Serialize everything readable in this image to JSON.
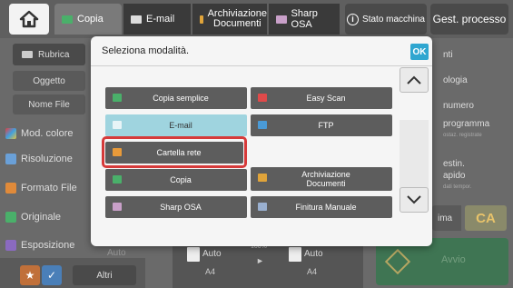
{
  "topbar": {
    "tabs": [
      {
        "label": "Copia"
      },
      {
        "label": "E-mail"
      },
      {
        "label_line1": "Archiviazione",
        "label_line2": "Documenti"
      },
      {
        "label": "Sharp OSA"
      }
    ],
    "stato": "Stato macchina",
    "gestione": "Gest. processo"
  },
  "left": {
    "rubrica": "Rubrica",
    "oggetto": "Oggetto",
    "nome_file": "Nome File",
    "mod_colore": "Mod. colore",
    "risoluzione": "Risoluzione",
    "formato_file": "Formato File",
    "originale": "Originale",
    "esposizione": "Esposizione",
    "esposizione_val": "Auto",
    "altri": "Altri"
  },
  "right": {
    "invii": "nti",
    "tipologia": "ologia",
    "numero": "numero",
    "programma": "programma",
    "programma_sub": "ostaz. registrate",
    "destin": "estin.",
    "rapido": "apido",
    "rapido_sub": "dati tempor.",
    "ima": "ima",
    "ca": "CA"
  },
  "bottom": {
    "auto1": "Auto",
    "a4_1": "A4",
    "pct": "100%",
    "auto2": "Auto",
    "a4_2": "A4",
    "avvio": "Avvio"
  },
  "dialog": {
    "title": "Seleziona modalità.",
    "ok": "OK",
    "modes": {
      "copia_semplice": "Copia semplice",
      "easy_scan": "Easy Scan",
      "email": "E-mail",
      "ftp": "FTP",
      "cartella_rete": "Cartella rete",
      "copia": "Copia",
      "arch_line1": "Archiviazione",
      "arch_line2": "Documenti",
      "sharp_osa": "Sharp OSA",
      "finitura_manuale": "Finitura Manuale"
    }
  },
  "colors": {
    "selected_mode": "#9fd4df",
    "highlight": "#d63a3a",
    "ok_button": "#2fa6d0",
    "start_button": "#2e7a4a"
  }
}
